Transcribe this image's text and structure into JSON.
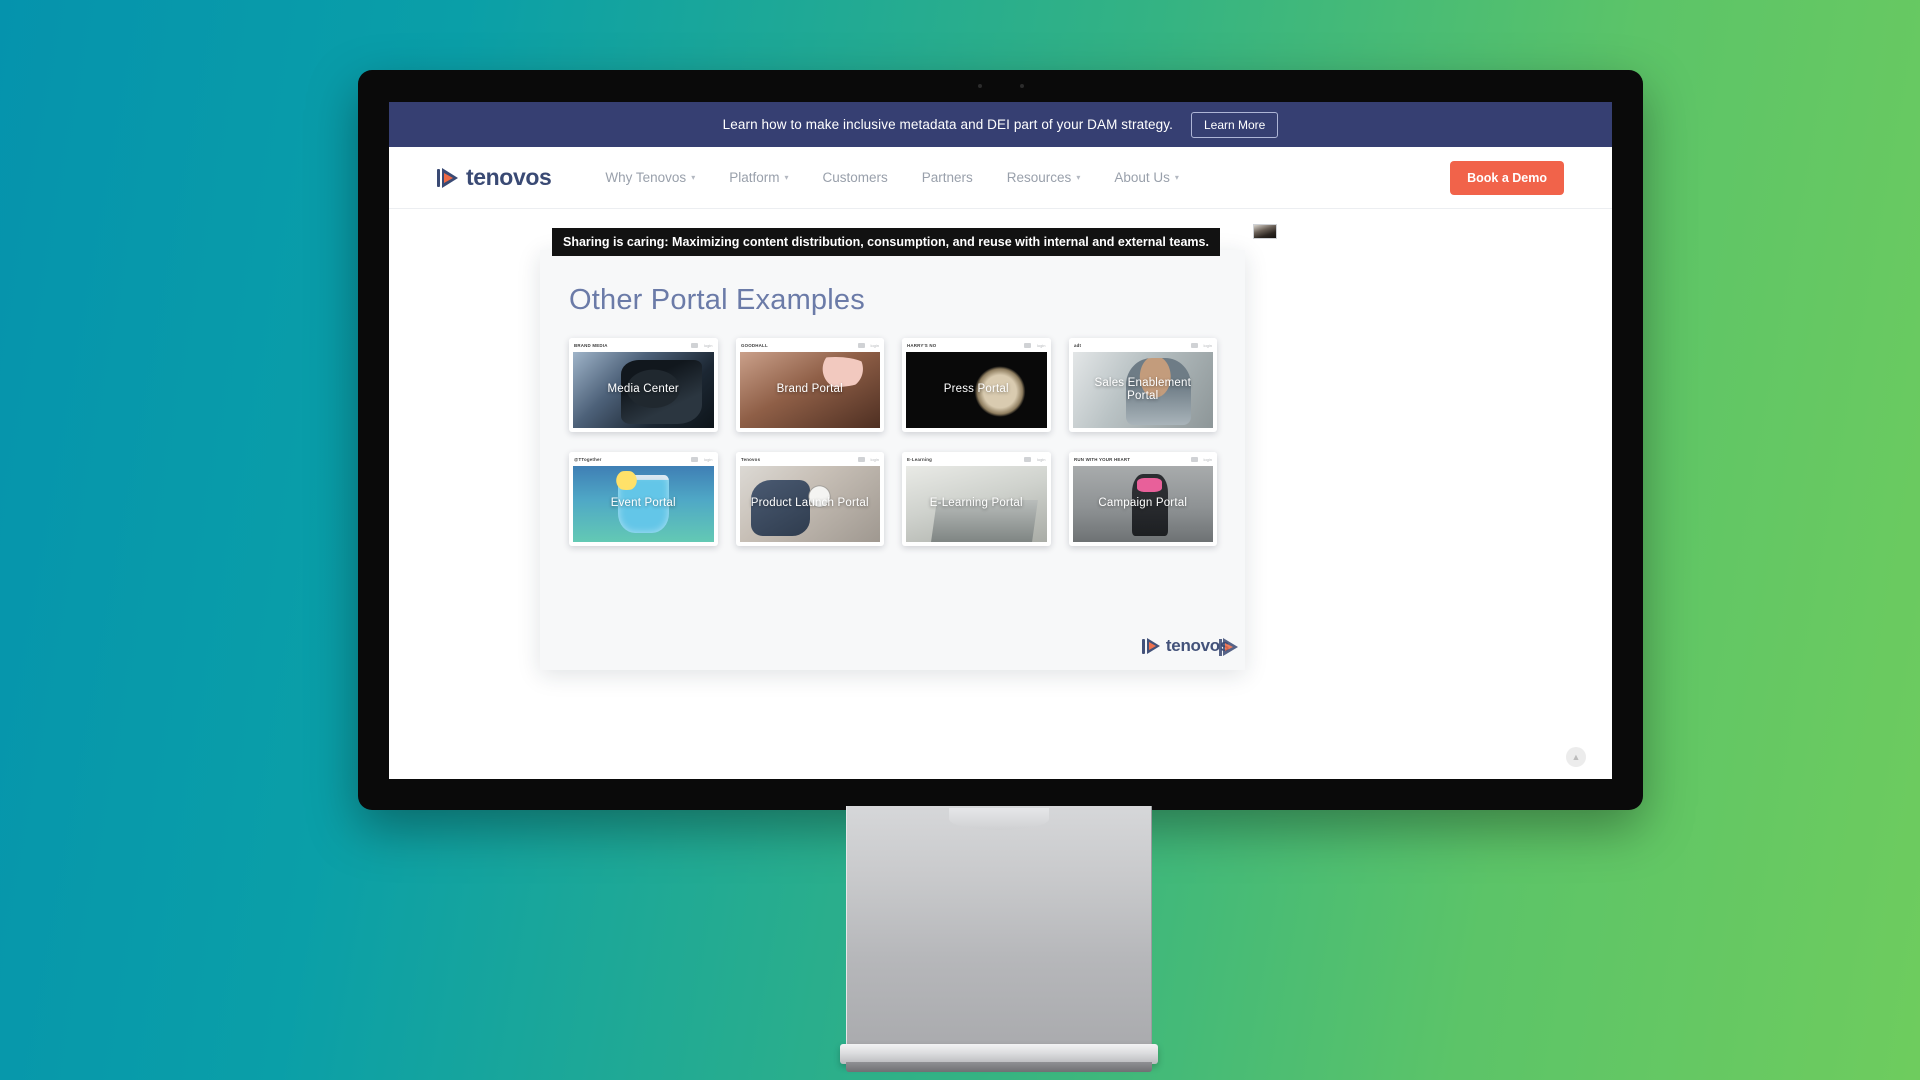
{
  "promo_banner": {
    "text": "Learn how to make inclusive metadata and DEI part of your DAM strategy.",
    "button_label": "Learn More",
    "background_color": "#363f72"
  },
  "nav": {
    "brand": "tenovos",
    "links": [
      {
        "label": "Why Tenovos",
        "has_dropdown": true
      },
      {
        "label": "Platform",
        "has_dropdown": true
      },
      {
        "label": "Customers",
        "has_dropdown": false
      },
      {
        "label": "Partners",
        "has_dropdown": false
      },
      {
        "label": "Resources",
        "has_dropdown": true
      },
      {
        "label": "About Us",
        "has_dropdown": true
      }
    ],
    "cta_label": "Book a Demo",
    "cta_color": "#f1634a"
  },
  "tooltip": {
    "text": "Sharing is caring: Maximizing content distribution, consumption, and reuse with internal and external teams."
  },
  "slide": {
    "title": "Other Portal Examples",
    "title_color": "#6b7ba8",
    "footer_brand": "tenovos",
    "cards": [
      {
        "caption": "Media Center",
        "chrome_logo": "BRAND MEDIA",
        "theme": "img-media"
      },
      {
        "caption": "Brand Portal",
        "chrome_logo": "GOODHALL",
        "theme": "img-brand"
      },
      {
        "caption": "Press Portal",
        "chrome_logo": "HARRY'S NO",
        "theme": "img-press"
      },
      {
        "caption": "Sales Enablement Portal",
        "chrome_logo": "adt",
        "theme": "img-sales"
      },
      {
        "caption": "Event Portal",
        "chrome_logo": "@TTogether",
        "theme": "img-event"
      },
      {
        "caption": "Product Launch Portal",
        "chrome_logo": "Tenovos",
        "theme": "img-product"
      },
      {
        "caption": "E-Learning Portal",
        "chrome_logo": "E-Learning",
        "theme": "img-elearn"
      },
      {
        "caption": "Campaign Portal",
        "chrome_logo": "RUN WITH YOUR HEART",
        "theme": "img-campaign"
      }
    ],
    "chrome_control_label": "login"
  },
  "scroll_top": {
    "glyph": "▲"
  },
  "background": {
    "gradient_start": "#0593ad",
    "gradient_end": "#6ecc5e"
  }
}
